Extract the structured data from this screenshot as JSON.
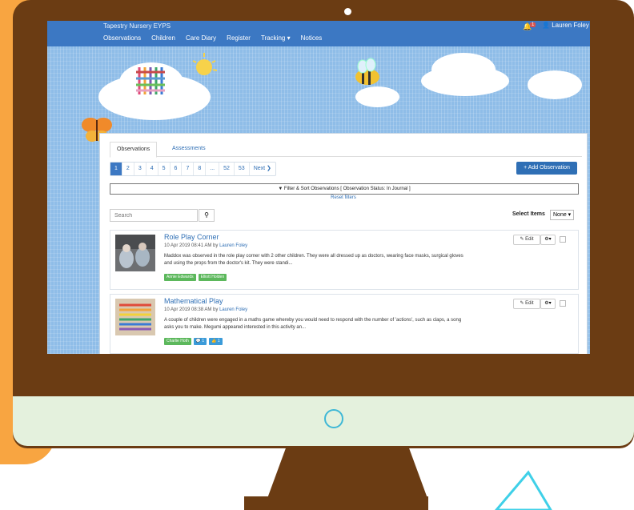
{
  "app": {
    "brand": "Tapestry Nursery EYPS",
    "nav": [
      "Observations",
      "Children",
      "Care Diary",
      "Register",
      "Tracking ▾",
      "Notices"
    ],
    "notification_count": "1",
    "user_name": "Lauren Foley ▾"
  },
  "tabs": [
    "Observations",
    "Assessments"
  ],
  "pagination": [
    "1",
    "2",
    "3",
    "4",
    "5",
    "6",
    "7",
    "8",
    "...",
    "52",
    "53",
    "Next ❯"
  ],
  "add_button": "+ Add Observation",
  "filter_bar": "▼ Filter & Sort Observations [ Observation Status: In Journal ]",
  "reset_filters": "Reset filters",
  "search": {
    "placeholder": "Search",
    "icon": "search-icon"
  },
  "select_items": {
    "label": "Select Items",
    "value": "None ▾"
  },
  "observations": [
    {
      "title": "Role Play Corner",
      "date": "10 Apr 2019 08:41 AM by",
      "author": "Lauren Foley",
      "text": "Maddox was observed in the role play corner with 2 other children. They were all dressed up as doctors, wearing face masks, surgical gloves and using the props from the doctor's kit. They were standi...",
      "tags": [
        "Annie Edwards",
        "Elliott Holden"
      ]
    },
    {
      "title": "Mathematical Play",
      "date": "10 Apr 2019 08:38 AM by",
      "author": "Lauren Foley",
      "text": "A couple of children were engaged in a maths game whereby you would need to respond with the number of 'actions', such as claps, a song asks you to make. Megumi appeared interested in this activity an...",
      "tags": [
        "Charlie Hoth",
        "1",
        "1"
      ]
    }
  ],
  "card_actions": {
    "edit": "✎ Edit",
    "gear": "⚙▾"
  },
  "colors": {
    "topbar": "#3c78c3",
    "primary": "#2f6fb5",
    "tag": "#5cb85c",
    "monitor": "#6b3c13",
    "accent_orange": "#f8a541"
  }
}
